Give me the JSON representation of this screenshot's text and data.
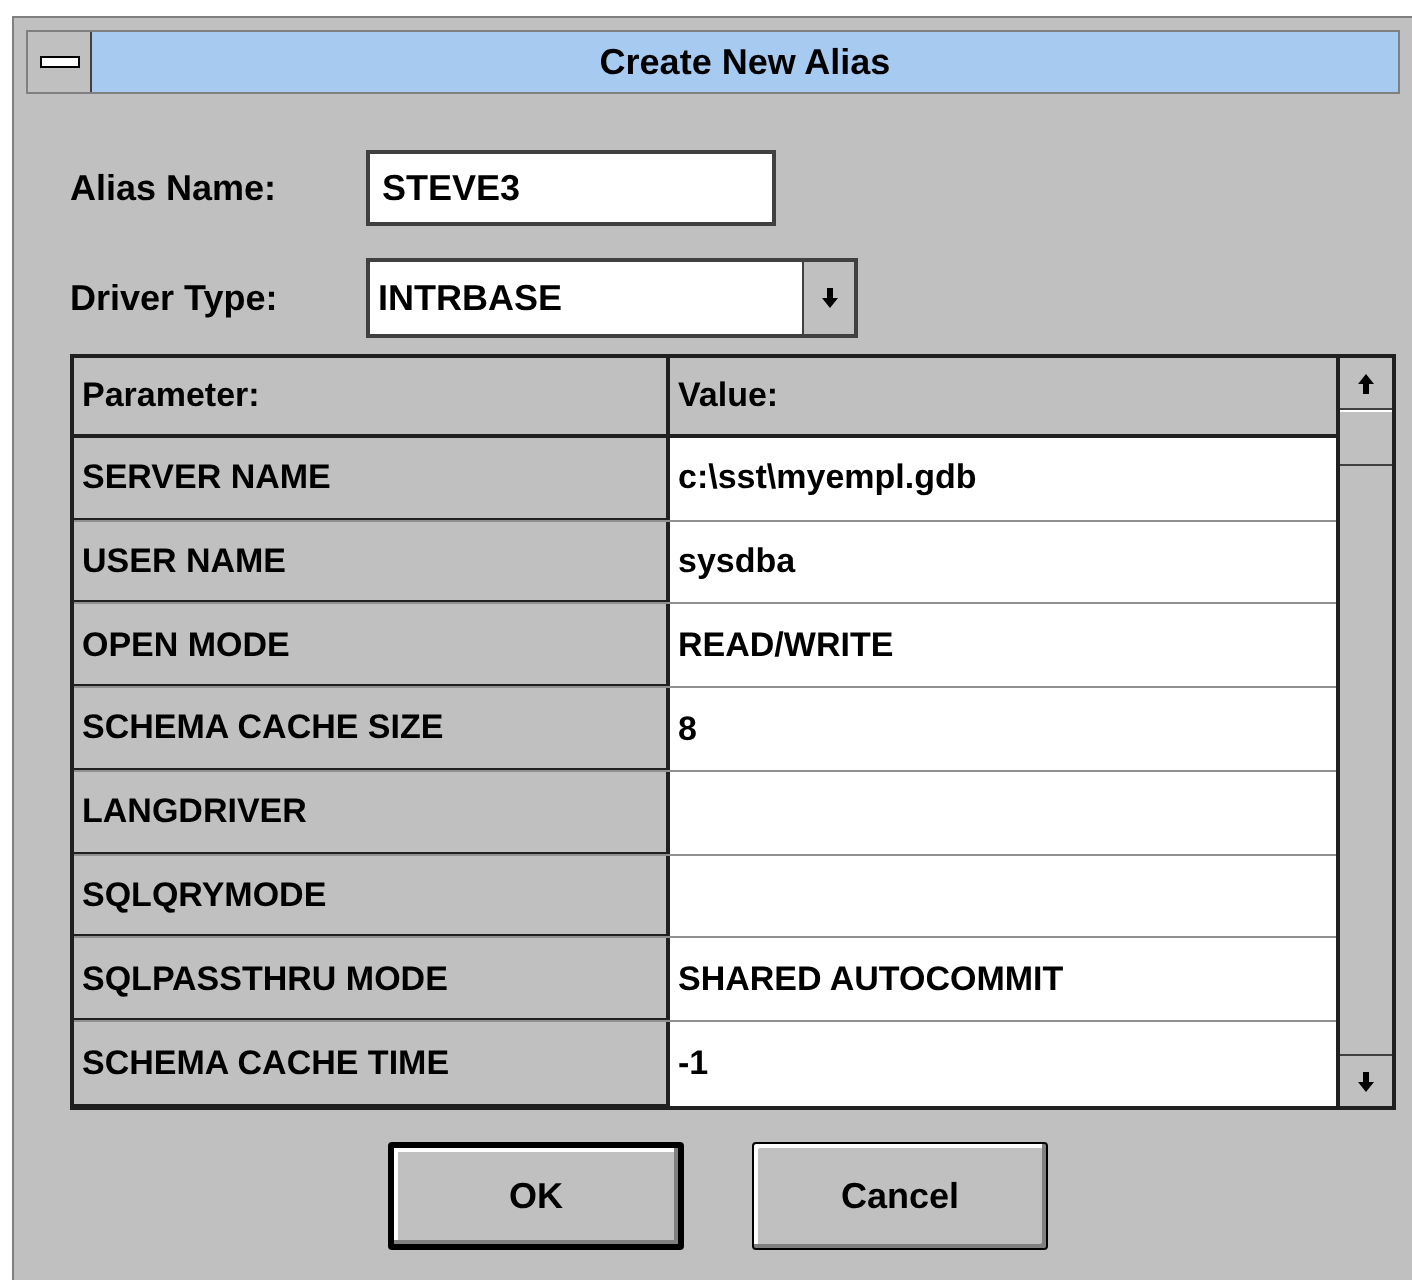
{
  "window": {
    "title": "Create New Alias"
  },
  "alias_name": {
    "label": "Alias Name:",
    "value": "STEVE3"
  },
  "driver_type": {
    "label": "Driver Type:",
    "value": "INTRBASE"
  },
  "table": {
    "columns": [
      "Parameter:",
      "Value:"
    ],
    "rows": [
      {
        "parameter": "SERVER NAME",
        "value": "c:\\sst\\myempl.gdb"
      },
      {
        "parameter": "USER NAME",
        "value": "sysdba"
      },
      {
        "parameter": "OPEN MODE",
        "value": "READ/WRITE"
      },
      {
        "parameter": "SCHEMA CACHE SIZE",
        "value": "8"
      },
      {
        "parameter": "LANGDRIVER",
        "value": ""
      },
      {
        "parameter": "SQLQRYMODE",
        "value": ""
      },
      {
        "parameter": "SQLPASSTHRU MODE",
        "value": "SHARED AUTOCOMMIT"
      },
      {
        "parameter": "SCHEMA CACHE TIME",
        "value": "-1"
      }
    ]
  },
  "buttons": [
    {
      "label": "OK",
      "default": true
    },
    {
      "label": "Cancel",
      "default": false
    }
  ]
}
